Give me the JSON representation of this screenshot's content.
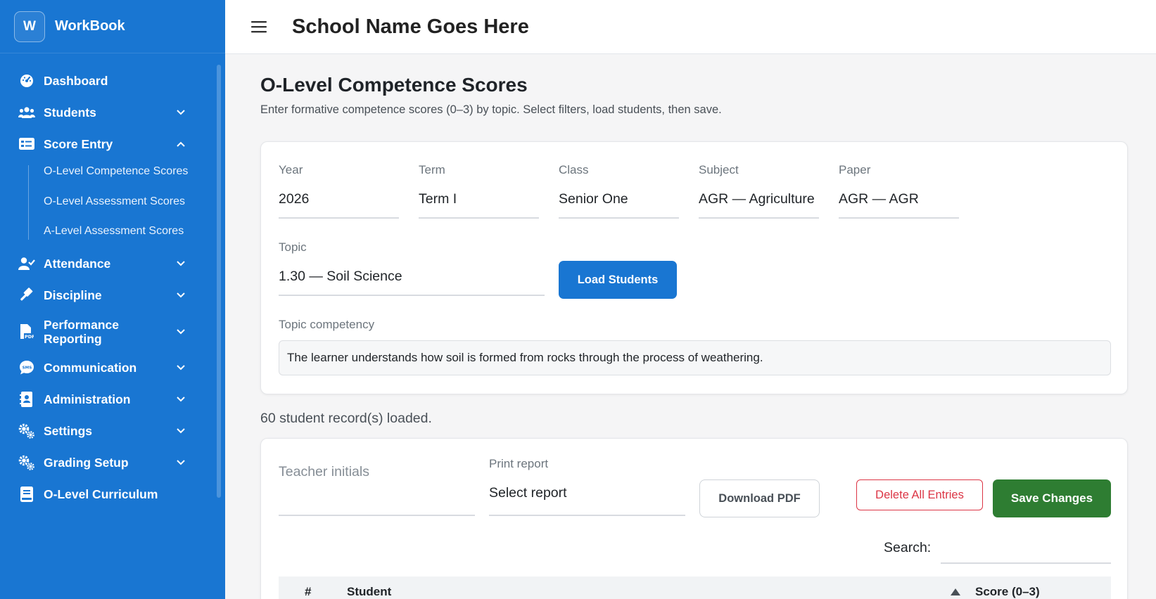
{
  "app": {
    "logo_letter": "W",
    "name": "WorkBook"
  },
  "sidebar": {
    "items_top": [
      {
        "label": "Dashboard",
        "icon": "gauge-icon",
        "has_chevron": false
      },
      {
        "label": "Students",
        "icon": "users-icon",
        "has_chevron": true,
        "chevron": "down"
      },
      {
        "label": "Score Entry",
        "icon": "id-card-icon",
        "has_chevron": true,
        "chevron": "up"
      }
    ],
    "sub_items": [
      {
        "label": "O-Level Competence Scores"
      },
      {
        "label": "O-Level Assessment Scores"
      },
      {
        "label": "A-Level Assessment Scores"
      }
    ],
    "items_bottom": [
      {
        "label": "Attendance",
        "icon": "user-check-icon",
        "has_chevron": true,
        "chevron": "down"
      },
      {
        "label": "Discipline",
        "icon": "gavel-icon",
        "has_chevron": true,
        "chevron": "down"
      },
      {
        "label": "Performance Reporting",
        "icon": "pdf-file-icon",
        "has_chevron": true,
        "chevron": "down"
      },
      {
        "label": "Communication",
        "icon": "sms-icon",
        "has_chevron": true,
        "chevron": "down"
      },
      {
        "label": "Administration",
        "icon": "contact-book-icon",
        "has_chevron": true,
        "chevron": "down"
      },
      {
        "label": "Settings",
        "icon": "gears-icon",
        "has_chevron": true,
        "chevron": "down"
      },
      {
        "label": "Grading Setup",
        "icon": "gears-icon",
        "has_chevron": true,
        "chevron": "down"
      },
      {
        "label": "O-Level Curriculum",
        "icon": "book-icon",
        "has_chevron": false
      }
    ]
  },
  "header": {
    "school_name": "School Name Goes Here"
  },
  "page": {
    "title": "O-Level Competence Scores",
    "subtitle": "Enter formative competence scores (0–3) by topic. Select filters, load students, then save."
  },
  "filters": {
    "year": {
      "label": "Year",
      "value": "2026"
    },
    "term": {
      "label": "Term",
      "value": "Term I"
    },
    "class": {
      "label": "Class",
      "value": "Senior One"
    },
    "subject": {
      "label": "Subject",
      "value": "AGR — Agriculture"
    },
    "paper": {
      "label": "Paper",
      "value": "AGR — AGR"
    },
    "topic": {
      "label": "Topic",
      "value": "1.30 — Soil Science"
    },
    "load_button": "Load Students",
    "competency_label": "Topic competency",
    "competency_text": "The learner understands how soil is formed from rocks through the process of weathering."
  },
  "records_loaded": "60 student record(s) loaded.",
  "toolbar": {
    "teacher_initials_placeholder": "Teacher initials",
    "print_report_label": "Print report",
    "print_report_value": "Select report",
    "download_pdf": "Download PDF",
    "delete_all": "Delete All Entries",
    "save_changes": "Save Changes",
    "search_label": "Search:"
  },
  "table": {
    "columns": [
      "#",
      "Student",
      "Score (0–3)"
    ]
  },
  "colors": {
    "sidebar": "#1976d2",
    "primary": "#1976d2",
    "success": "#2e7d32",
    "danger": "#dc3545"
  }
}
